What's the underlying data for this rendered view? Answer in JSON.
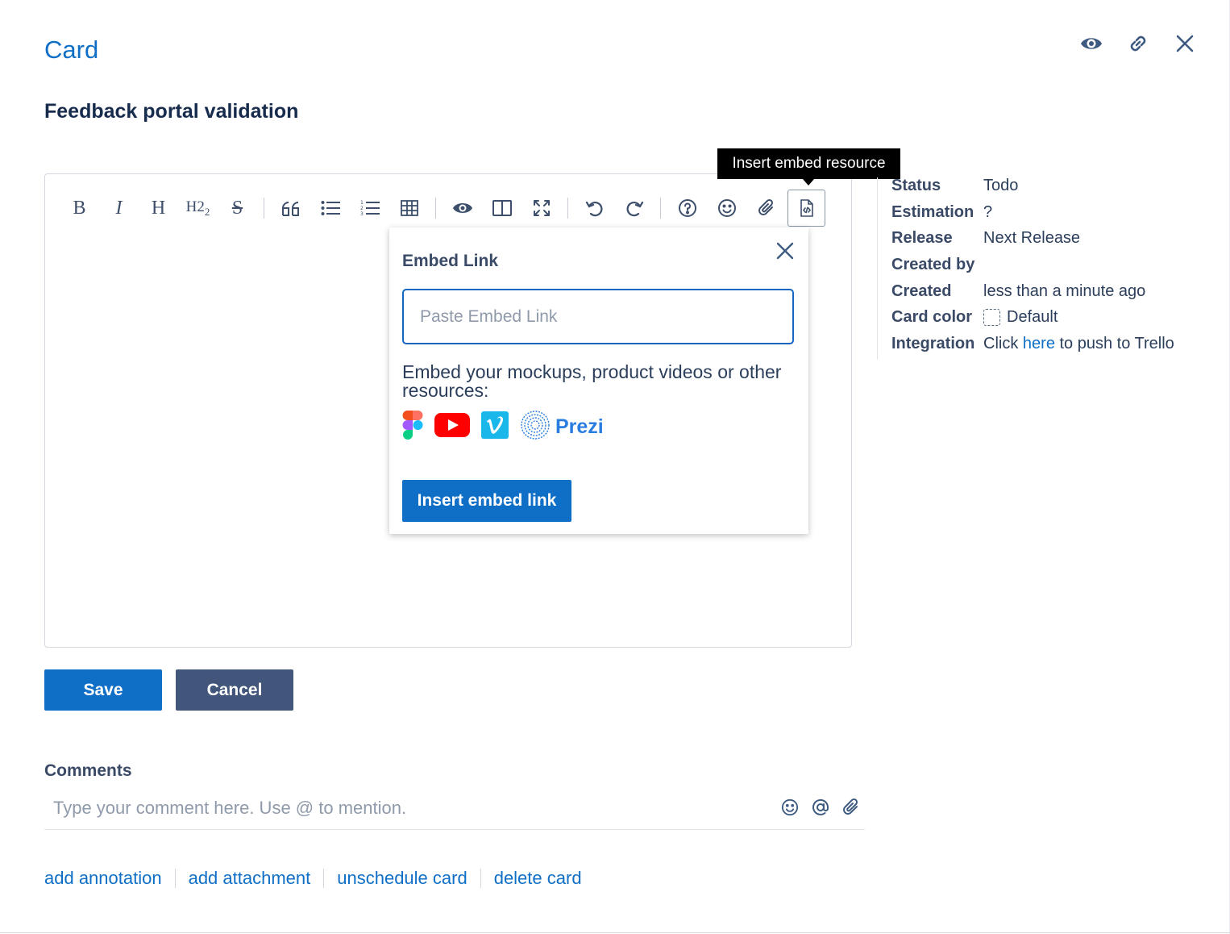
{
  "header": {
    "title": "Card",
    "card_name": "Feedback portal validation",
    "icons": [
      "eye-icon",
      "link-icon",
      "close-icon"
    ]
  },
  "toolbar": {
    "tooltip": "Insert embed resource",
    "buttons": [
      "bold",
      "italic",
      "heading",
      "heading-smaller",
      "strikethrough",
      "quote",
      "unordered-list",
      "ordered-list",
      "table",
      "preview",
      "side-by-side",
      "fullscreen",
      "undo",
      "redo",
      "guide",
      "emoji",
      "attachment",
      "embed"
    ]
  },
  "embed_popup": {
    "title": "Embed Link",
    "input_placeholder": "Paste Embed Link",
    "description": "Embed your mockups, product videos or other resources:",
    "logos": [
      "figma-icon",
      "youtube-icon",
      "vimeo-icon",
      "prezi-icon"
    ],
    "prezi_label": "Prezi",
    "insert_label": "Insert embed link"
  },
  "meta": {
    "status_label": "Status",
    "status_value": "Todo",
    "estimation_label": "Estimation",
    "estimation_value": "?",
    "release_label": "Release",
    "release_value": "Next Release",
    "created_by_label": "Created by",
    "created_by_value": "",
    "created_label": "Created",
    "created_value": "less than a minute ago",
    "card_color_label": "Card color",
    "card_color_value": "Default",
    "integration_label": "Integration",
    "integration_prefix": "Click",
    "integration_link": "here",
    "integration_suffix": "to push to Trello"
  },
  "buttons": {
    "save_label": "Save",
    "cancel_label": "Cancel"
  },
  "comments": {
    "label": "Comments",
    "placeholder": "Type your comment here. Use @ to mention."
  },
  "actions": {
    "add_annotation": "add annotation",
    "add_attachment": "add attachment",
    "unschedule_card": "unschedule card",
    "delete_card": "delete card"
  },
  "colors": {
    "primary": "#0f6fc6",
    "secondary_button": "#41567a",
    "text_dark": "#172b4d",
    "label": "#3a4a66"
  }
}
